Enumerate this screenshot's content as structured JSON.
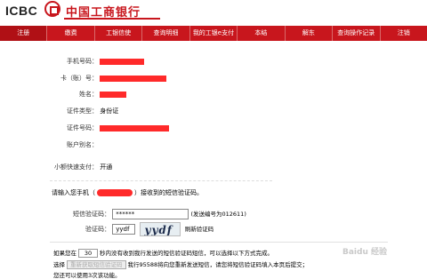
{
  "header": {
    "logo_text": "ICBC",
    "bank_name": "中国工商银行"
  },
  "nav": {
    "items": [
      {
        "label": "注册"
      },
      {
        "label": "缴费"
      },
      {
        "label": "工银信使"
      },
      {
        "label": "查询明细"
      },
      {
        "label": "我的工银e支付"
      },
      {
        "label": "本结"
      },
      {
        "label": "解东"
      },
      {
        "label": "查询操作记录"
      },
      {
        "label": "注销"
      }
    ],
    "active_index": 0
  },
  "form": {
    "phone_label": "手机号码：",
    "card_label": "卡（账）号：",
    "name_label": "姓名：",
    "id_type_label": "证件类型：",
    "id_type_value": "身份证",
    "id_number_label": "证件号码：",
    "alias_label": "账户别名：",
    "quickpay_label": "小额快速支付：",
    "quickpay_value": "开通"
  },
  "verify": {
    "prompt_prefix": "请输入您手机（",
    "prompt_suffix": "）接收到的短信验证码。",
    "sms_code_label": "短信验证码：",
    "sms_code_value": "******",
    "sms_code_note": "(发送编号为012611)",
    "captcha_label": "验证码：",
    "captcha_input": "yydf",
    "captcha_image_text": "yydf",
    "refresh_label": "刷新验证码"
  },
  "help": {
    "line1_prefix": "如果您在",
    "line1_seconds": "30",
    "line1_suffix": "秒内没有收到我行发送的短信验证码短信，可以选择以下方式完成。",
    "line2_prefix": "选择",
    "resend_button": "重新获取短信验证码",
    "line2_suffix": "我行95588将向您重新发送短信，请您将短信验证码填入本页后提交；",
    "line3": "您还可以使用3次该功能。"
  },
  "watermark": "Baidu 经验",
  "colors": {
    "brand": "#c8161d",
    "redaction": "#ff2a2a"
  }
}
